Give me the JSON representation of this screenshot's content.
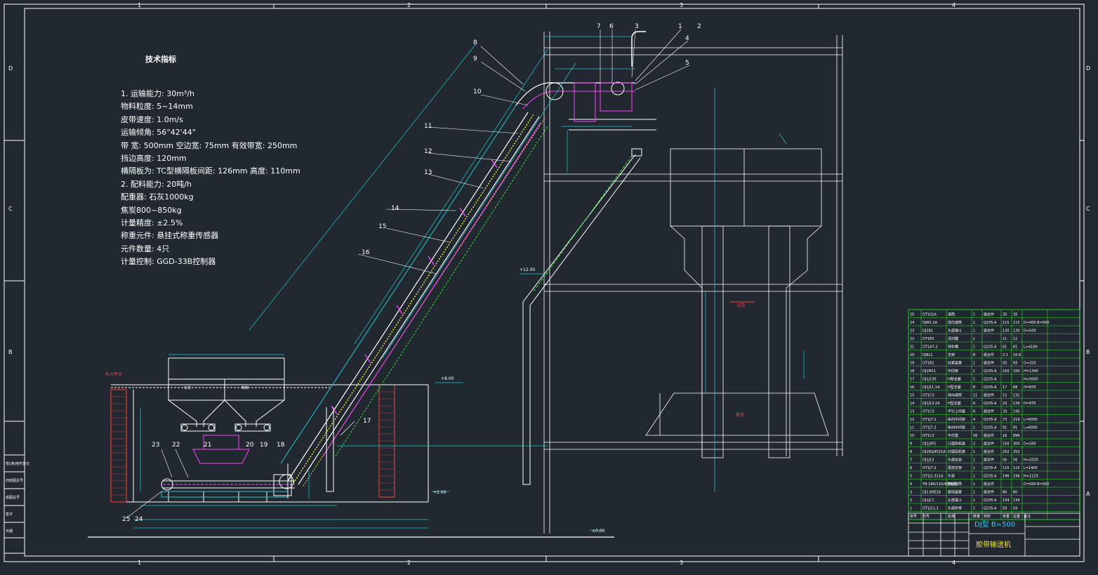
{
  "border_refs": {
    "columns": [
      "1",
      "2",
      "3",
      "4"
    ],
    "rows": [
      "D",
      "C",
      "B",
      "A"
    ]
  },
  "spec": {
    "title": "技术指标",
    "lines": [
      "1. 运输能力: 30m³/h",
      "   物料粒度: 5~14mm",
      "   皮带速度: 1.0m/s",
      "   运输倾角: 56°42'44\"",
      "   带    宽: 500mm     空边宽: 75mm   有效带宽: 250mm",
      "   挡边高度: 120mm",
      "   横隔板为: TC型横隔板间距: 126mm   高度: 110mm",
      "2. 配料能力: 20吨/h",
      "   配重器: 石灰1000kg",
      "          焦炭800~850kg",
      "   计量精度:  ±2.5%",
      "   称重元件: 悬挂式称重传感器",
      "   元件数量: 4只",
      "   计量控制: GGD-33B控制器"
    ]
  },
  "callouts": [
    "1",
    "2",
    "3",
    "4",
    "5",
    "6",
    "7",
    "8",
    "9",
    "10",
    "11",
    "12",
    "13",
    "14",
    "15",
    "16",
    "17",
    "18",
    "19",
    "20",
    "21",
    "22",
    "23",
    "24",
    "25"
  ],
  "elevations": [
    "+8.00",
    "+2.00",
    "+12.00",
    "±0.00"
  ],
  "labels": {
    "material_platform": "料斗平台",
    "lime": "石灰",
    "coke": "焦炭"
  },
  "parts_table": {
    "rows": [
      [
        "25",
        "DT101A",
        "滚筒",
        "1",
        "组合件",
        "35",
        "35",
        ""
      ],
      [
        "24",
        "DJM1.1A",
        "改向滚筒",
        "1",
        "Q235-A",
        "115",
        "115",
        "D=400 B=500"
      ],
      [
        "23",
        "DJ1B1",
        "头部漏斗",
        "1",
        "组合件",
        "130",
        "130",
        "D=500"
      ],
      [
        "22",
        "DT1E0",
        "清扫器",
        "1",
        "",
        "11",
        "11",
        ""
      ],
      [
        "21",
        "DT1A7-2",
        "导料槽",
        "1",
        "Q235-A",
        "61",
        "61",
        "L=4100"
      ],
      [
        "20",
        "DJ8L1",
        "支架",
        "8",
        "组合件",
        "2.1",
        "16.8",
        ""
      ],
      [
        "19",
        "DT1B1",
        "拉紧装置",
        "1",
        "组合件",
        "93",
        "93",
        "D=320"
      ],
      [
        "18",
        "DJ1M11",
        "中间架",
        "1",
        "Q235-A",
        "160",
        "160",
        "H=1340"
      ],
      [
        "17",
        "DJ1J130",
        "H型支腿",
        "1",
        "Q235-A",
        "",
        "",
        "H=5000"
      ],
      [
        "16",
        "DJ1J11.1A",
        "H型支腿",
        "8",
        "Q235-A",
        "17",
        "68",
        "H=870"
      ],
      [
        "15",
        "DT1C3",
        "导向滚筒",
        "11",
        "组合件",
        "12",
        "132",
        ""
      ],
      [
        "14",
        "DJ1J13.2A",
        "H型支腿",
        "6",
        "Q235-A",
        "23",
        "139",
        "H=870"
      ],
      [
        "13",
        "DT1C5",
        "平行上托辊",
        "6",
        "组合件",
        "33",
        "195",
        ""
      ],
      [
        "12",
        "DT1J7-1",
        "纵向中间架",
        "4",
        "Q235-A",
        "73",
        "219",
        "L=6000"
      ],
      [
        "11",
        "DT1J7-2",
        "纵向中间架",
        "1",
        "Q235-A",
        "91",
        "91",
        "L=6000"
      ],
      [
        "10",
        "DT1C2",
        "平托辊",
        "56",
        "组合件",
        "16",
        "896",
        ""
      ],
      [
        "9",
        "DJ1J3F5",
        "凸弧段机架",
        "2",
        "组合件",
        "150",
        "300",
        "D=500"
      ],
      [
        "8",
        "DJ1B1J4521A",
        "凹弧段机架",
        "1",
        "组合件",
        "252",
        "252",
        ""
      ],
      [
        "7",
        "DJ1J13",
        "头部支架",
        "1",
        "组合件",
        "56",
        "56",
        "H=1020"
      ],
      [
        "6",
        "DT1J7-2",
        "尾部支架",
        "1",
        "Q235-A",
        "115",
        "115",
        "L=1400"
      ],
      [
        "5",
        "DT1J1-311A",
        "头架",
        "1",
        "Q235-A",
        "196",
        "196",
        "H=1120"
      ],
      [
        "4",
        "YB-180/110/4型电机",
        "电动滚筒",
        "1",
        "组合件",
        "",
        "",
        "D=500 B=500"
      ],
      [
        "3",
        "DJ1.B0E16",
        "驱动装置",
        "1",
        "组合件",
        "80",
        "80",
        ""
      ],
      [
        "2",
        "DJ1JC1",
        "头部漏斗",
        "1",
        "Q235-A",
        "134",
        "134",
        ""
      ],
      [
        "1",
        "DT1J11-1",
        "头部护罩",
        "1",
        "Q235-A",
        "59",
        "59",
        ""
      ]
    ],
    "header": [
      "序号",
      "代号",
      "名称",
      "数量",
      "材料",
      "单重",
      "总重",
      "备注"
    ]
  },
  "title_block": {
    "main": "DJ型 B=500",
    "sub": "胶带输送机"
  },
  "left_strip": [
    "底图总号",
    "签字",
    "日期",
    "旧底图总号",
    "借(通)用件登记"
  ],
  "colors": {
    "background": "#212830",
    "frame": "#ffffff",
    "cyan": "#21c6cf",
    "yellow": "#f0e040",
    "magenta": "#ff40ff",
    "brick": "#c83c3c",
    "green": "#30e030"
  }
}
